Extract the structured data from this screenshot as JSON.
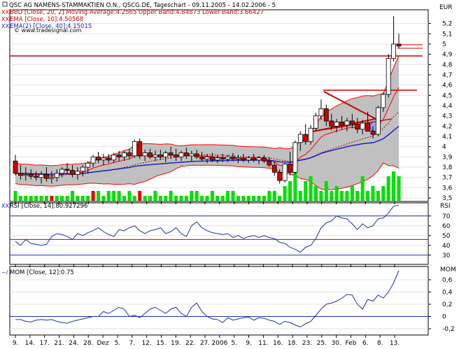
{
  "header": {
    "title": "QSC AG NAMENS-STAMMAKTIEN O.N., QSCG.DE, Tageschart - 09.11.2005 - 14.02.2006 - 5",
    "bbd_label": "BBD [Close, 20, 2] Moving Average:4.2565 Upper Band:4.84873 Lower Band:3.66427",
    "ema10_label": "EMA [Close, 10]:4.50568",
    "ema40_label": "EMA(2) [Close, 40]:4.15015",
    "currency": "EUR",
    "watermark": "© www.tradesignal.com"
  },
  "rsi_panel": {
    "label": "RSI [Close, 14]:80.927296",
    "axis_label": "RSI"
  },
  "mom_panel": {
    "label": "MOM [Close, 12]:0.75",
    "axis_label": "MOM"
  },
  "colors": {
    "up_candle": "#ffffff",
    "down_candle": "#cc0000",
    "band_fill": "#c0c0c0",
    "band_line": "#ff0000",
    "ema_blue": "#2020c0",
    "volume": "#00e000",
    "volume_down": "#ee0000",
    "trend_red": "#cc0000",
    "indicator_line": "#2030b0"
  },
  "chart_data": [
    {
      "type": "candlestick",
      "yticks": [
        "5,2",
        "5,1",
        "5",
        "4,9",
        "4,8",
        "4,7",
        "4,6",
        "4,5",
        "4,4",
        "4,3",
        "4,2",
        "4,1",
        "4",
        "3,9",
        "3,8",
        "3,7",
        "3,6",
        "3,5"
      ],
      "ylim": [
        3.48,
        5.32
      ],
      "xticks": [
        "9.",
        "14.",
        "17.",
        "21.",
        "24.",
        "28.",
        "Dez",
        "5.",
        "7.",
        "12.",
        "15.",
        "19.",
        "22.",
        "27.",
        "2006",
        "5.",
        "9.",
        "11.",
        "16.",
        "18.",
        "23.",
        "25.",
        "30.",
        "Feb",
        "6.",
        "8.",
        "13."
      ],
      "ohlc": [
        [
          3.86,
          3.92,
          3.72,
          3.74
        ],
        [
          3.74,
          3.82,
          3.68,
          3.72
        ],
        [
          3.72,
          3.8,
          3.67,
          3.73
        ],
        [
          3.73,
          3.78,
          3.68,
          3.71
        ],
        [
          3.71,
          3.76,
          3.67,
          3.7
        ],
        [
          3.7,
          3.76,
          3.64,
          3.73
        ],
        [
          3.73,
          3.8,
          3.66,
          3.69
        ],
        [
          3.69,
          3.76,
          3.64,
          3.7
        ],
        [
          3.7,
          3.78,
          3.66,
          3.74
        ],
        [
          3.74,
          3.8,
          3.7,
          3.78
        ],
        [
          3.78,
          3.84,
          3.73,
          3.77
        ],
        [
          3.77,
          3.82,
          3.7,
          3.73
        ],
        [
          3.73,
          3.8,
          3.68,
          3.76
        ],
        [
          3.76,
          3.82,
          3.71,
          3.8
        ],
        [
          3.8,
          3.86,
          3.74,
          3.84
        ],
        [
          3.84,
          3.92,
          3.8,
          3.9
        ],
        [
          3.9,
          3.95,
          3.84,
          3.87
        ],
        [
          3.87,
          3.93,
          3.82,
          3.89
        ],
        [
          3.89,
          3.93,
          3.84,
          3.87
        ],
        [
          3.87,
          3.94,
          3.84,
          3.92
        ],
        [
          3.92,
          3.96,
          3.86,
          3.9
        ],
        [
          3.9,
          3.96,
          3.86,
          3.94
        ],
        [
          3.94,
          3.98,
          3.88,
          3.91
        ],
        [
          3.91,
          4.07,
          3.89,
          4.05
        ],
        [
          4.05,
          4.08,
          3.88,
          3.91
        ],
        [
          3.91,
          3.97,
          3.86,
          3.94
        ],
        [
          3.94,
          3.98,
          3.88,
          3.9
        ],
        [
          3.9,
          3.96,
          3.86,
          3.92
        ],
        [
          3.92,
          3.97,
          3.87,
          3.9
        ],
        [
          3.9,
          3.96,
          3.85,
          3.94
        ],
        [
          3.94,
          4.0,
          3.88,
          3.92
        ],
        [
          3.92,
          3.98,
          3.86,
          3.9
        ],
        [
          3.9,
          3.96,
          3.86,
          3.94
        ],
        [
          3.94,
          3.99,
          3.88,
          3.91
        ],
        [
          3.91,
          3.96,
          3.86,
          3.93
        ],
        [
          3.93,
          3.97,
          3.88,
          3.9
        ],
        [
          3.9,
          3.95,
          3.86,
          3.88
        ],
        [
          3.88,
          3.93,
          3.84,
          3.9
        ],
        [
          3.9,
          3.94,
          3.85,
          3.87
        ],
        [
          3.87,
          3.92,
          3.84,
          3.89
        ],
        [
          3.89,
          3.93,
          3.85,
          3.88
        ],
        [
          3.88,
          3.92,
          3.85,
          3.9
        ],
        [
          3.9,
          3.94,
          3.86,
          3.88
        ],
        [
          3.88,
          3.92,
          3.84,
          3.89
        ],
        [
          3.89,
          3.93,
          3.85,
          3.87
        ],
        [
          3.87,
          3.91,
          3.84,
          3.89
        ],
        [
          3.89,
          3.93,
          3.85,
          3.87
        ],
        [
          3.87,
          3.91,
          3.83,
          3.89
        ],
        [
          3.89,
          3.92,
          3.84,
          3.86
        ],
        [
          3.86,
          3.9,
          3.8,
          3.82
        ],
        [
          3.82,
          3.85,
          3.72,
          3.75
        ],
        [
          3.75,
          3.78,
          3.64,
          3.67
        ],
        [
          3.67,
          3.84,
          3.65,
          3.83
        ],
        [
          3.83,
          3.95,
          3.72,
          3.75
        ],
        [
          3.75,
          4.06,
          3.73,
          4.04
        ],
        [
          4.04,
          4.15,
          3.96,
          4.12
        ],
        [
          4.12,
          4.22,
          4.02,
          4.05
        ],
        [
          4.05,
          4.21,
          4.02,
          4.18
        ],
        [
          4.18,
          4.33,
          4.15,
          4.3
        ],
        [
          4.3,
          4.46,
          4.26,
          4.37
        ],
        [
          4.37,
          4.41,
          4.2,
          4.25
        ],
        [
          4.25,
          4.32,
          4.16,
          4.2
        ],
        [
          4.2,
          4.27,
          4.14,
          4.24
        ],
        [
          4.24,
          4.3,
          4.17,
          4.21
        ],
        [
          4.21,
          4.28,
          4.15,
          4.25
        ],
        [
          4.25,
          4.32,
          4.18,
          4.22
        ],
        [
          4.22,
          4.28,
          4.13,
          4.17
        ],
        [
          4.17,
          4.26,
          4.12,
          4.23
        ],
        [
          4.23,
          4.34,
          4.2,
          4.15
        ],
        [
          4.15,
          4.2,
          4.08,
          4.12
        ],
        [
          4.12,
          4.4,
          4.1,
          4.38
        ],
        [
          4.38,
          4.53,
          4.34,
          4.51
        ],
        [
          4.51,
          4.9,
          4.48,
          4.86
        ],
        [
          4.86,
          5.27,
          4.83,
          5.0
        ],
        [
          5.0,
          5.1,
          4.96,
          4.98
        ]
      ],
      "volume": [
        2,
        1,
        1,
        1,
        1,
        1,
        1,
        1,
        1,
        1,
        1,
        2,
        1,
        1,
        1,
        2,
        2,
        1,
        2,
        2,
        2,
        1,
        2,
        1,
        2,
        1,
        1,
        2,
        1,
        1,
        2,
        1,
        1,
        1,
        2,
        2,
        1,
        1,
        2,
        1,
        1,
        2,
        2,
        1,
        1,
        1,
        1,
        1,
        1,
        2,
        2,
        1,
        3,
        4,
        7,
        2,
        4,
        5,
        3,
        2,
        4,
        2,
        3,
        2,
        2,
        3,
        2,
        5,
        2,
        3,
        2,
        3,
        5,
        6,
        5
      ],
      "horizontal_lines": [
        4.83,
        4.47
      ]
    },
    {
      "type": "line",
      "name": "RSI",
      "yticks": [
        "70",
        "60",
        "50",
        "40",
        "30"
      ],
      "ylim": [
        22,
        82
      ],
      "hlines": [
        70,
        46,
        30
      ],
      "values": [
        44,
        40,
        46,
        42,
        41,
        40,
        41,
        49,
        52,
        51,
        49,
        46,
        52,
        50,
        53,
        55,
        58,
        54,
        51,
        49,
        56,
        55,
        58,
        60,
        55,
        52,
        55,
        56,
        58,
        52,
        54,
        58,
        52,
        49,
        60,
        64,
        58,
        55,
        53,
        52,
        51,
        52,
        48,
        50,
        47,
        49,
        50,
        48,
        50,
        48,
        47,
        43,
        42,
        38,
        36,
        33,
        38,
        40,
        47,
        58,
        63,
        65,
        70,
        68,
        67,
        62,
        56,
        62,
        58,
        60,
        67,
        68,
        73,
        80,
        81
      ]
    },
    {
      "type": "line",
      "name": "MOM",
      "yticks": [
        "0,6",
        "0,4",
        "0,2",
        "0",
        "-0,2"
      ],
      "ylim": [
        -0.28,
        0.76
      ],
      "hlines": [
        0
      ],
      "values": [
        -0.05,
        -0.05,
        -0.08,
        -0.09,
        -0.06,
        -0.05,
        -0.06,
        -0.05,
        -0.08,
        -0.1,
        -0.11,
        -0.08,
        -0.06,
        -0.04,
        -0.02,
        0.0,
        0.0,
        0.08,
        0.05,
        0.1,
        0.15,
        0.12,
        0.0,
        0.02,
        -0.02,
        0.05,
        0.12,
        0.15,
        0.1,
        0.05,
        0.12,
        0.15,
        0.05,
        0.0,
        0.15,
        0.22,
        0.08,
        0.0,
        -0.04,
        -0.05,
        -0.1,
        -0.02,
        -0.06,
        -0.04,
        -0.02,
        -0.01,
        -0.06,
        -0.02,
        -0.03,
        -0.06,
        -0.08,
        -0.13,
        -0.08,
        -0.1,
        -0.14,
        -0.17,
        -0.12,
        -0.08,
        0.02,
        0.12,
        0.2,
        0.22,
        0.25,
        0.3,
        0.36,
        0.35,
        0.2,
        0.12,
        0.28,
        0.25,
        0.35,
        0.3,
        0.4,
        0.55,
        0.75
      ]
    }
  ]
}
